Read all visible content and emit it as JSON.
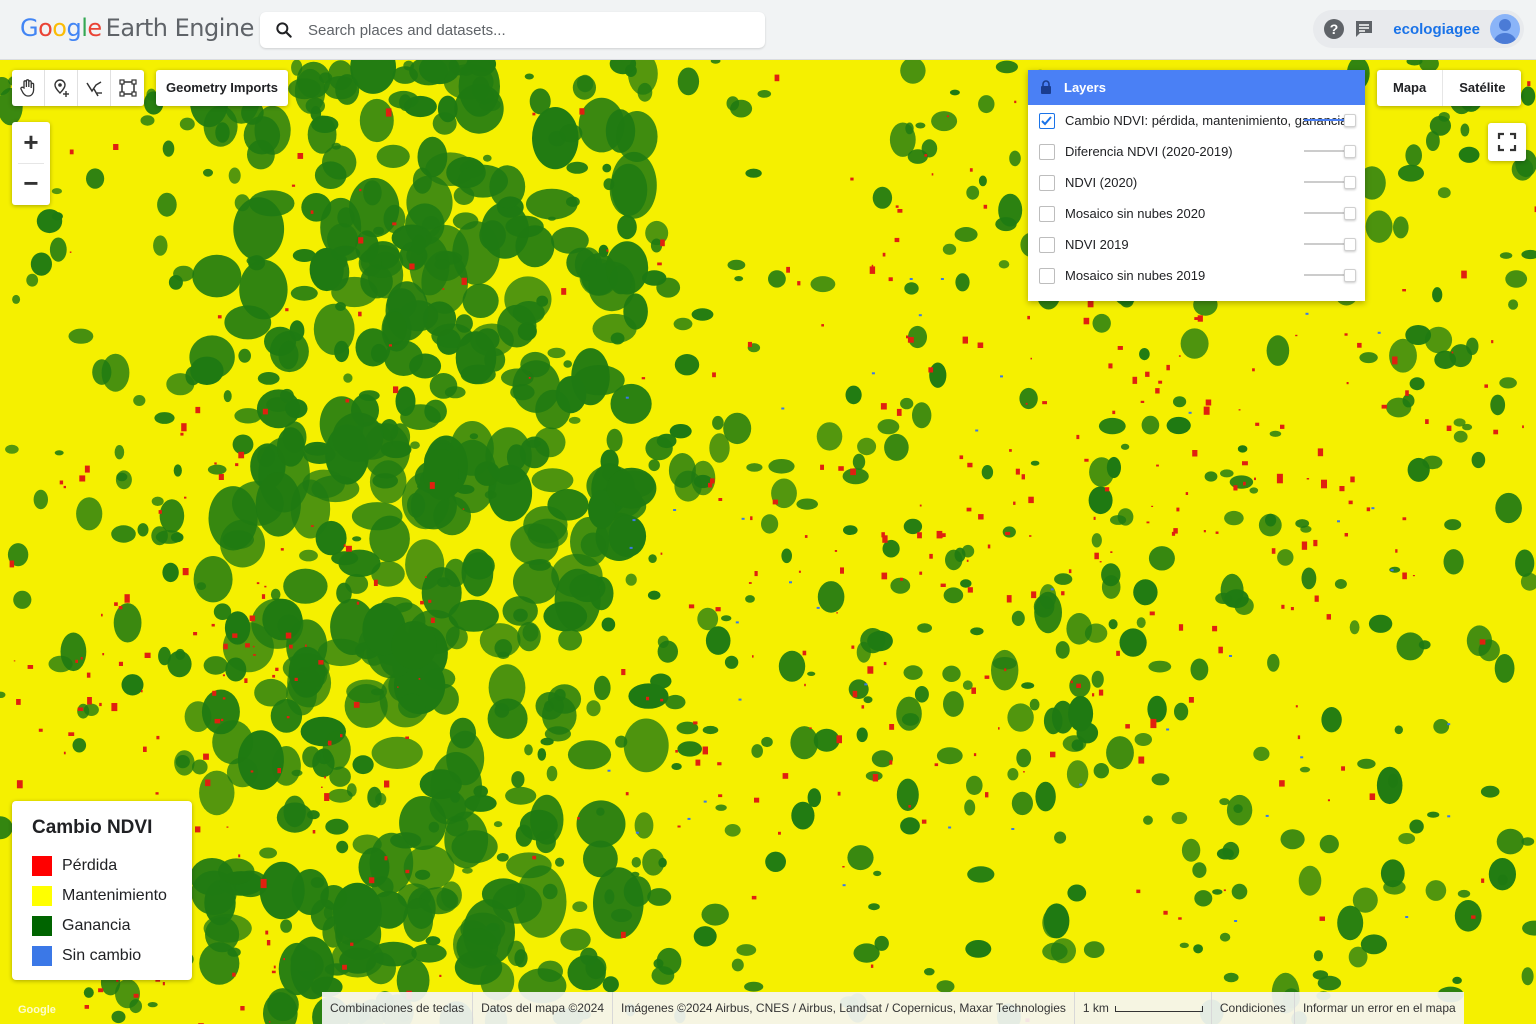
{
  "header": {
    "logo_google": [
      "G",
      "o",
      "o",
      "g",
      "l",
      "e"
    ],
    "logo_product": "Earth Engine",
    "search_placeholder": "Search places and datasets...",
    "user_name": "ecologiagee"
  },
  "map_tools": {
    "icons": [
      "hand-pan-icon",
      "marker-pin-icon",
      "polyline-icon",
      "rectangle-icon"
    ],
    "geometry_imports_label": "Geometry Imports",
    "zoom_in_label": "+",
    "zoom_out_label": "−"
  },
  "layers_panel": {
    "title": "Layers",
    "items": [
      {
        "label": "Cambio NDVI: pérdida, mantenimiento, ganancia",
        "checked": true
      },
      {
        "label": "Diferencia NDVI (2020-2019)",
        "checked": false
      },
      {
        "label": "NDVI (2020)",
        "checked": false
      },
      {
        "label": "Mosaico sin nubes 2020",
        "checked": false
      },
      {
        "label": "NDVI 2019",
        "checked": false
      },
      {
        "label": "Mosaico sin nubes 2019",
        "checked": false
      }
    ]
  },
  "map_type": {
    "map_label": "Mapa",
    "satellite_label": "Satélite"
  },
  "legend": {
    "title": "Cambio NDVI",
    "items": [
      {
        "label": "Pérdida",
        "color": "#ff0000"
      },
      {
        "label": "Mantenimiento",
        "color": "#ffff00"
      },
      {
        "label": "Ganancia",
        "color": "#006400"
      },
      {
        "label": "Sin cambio",
        "color": "#3b78e7"
      }
    ]
  },
  "map_colors": {
    "maintenance": "#f5f000",
    "gain": "#1f7a12",
    "loss": "#e02010",
    "no_change": "#3b78e7"
  },
  "footer": {
    "shortcuts": "Combinaciones de teclas",
    "map_data": "Datos del mapa ©2024",
    "imagery": "Imágenes ©2024 Airbus, CNES / Airbus, Landsat / Copernicus, Maxar Technologies",
    "scale": "1 km",
    "terms": "Condiciones",
    "report": "Informar un error en el mapa"
  }
}
